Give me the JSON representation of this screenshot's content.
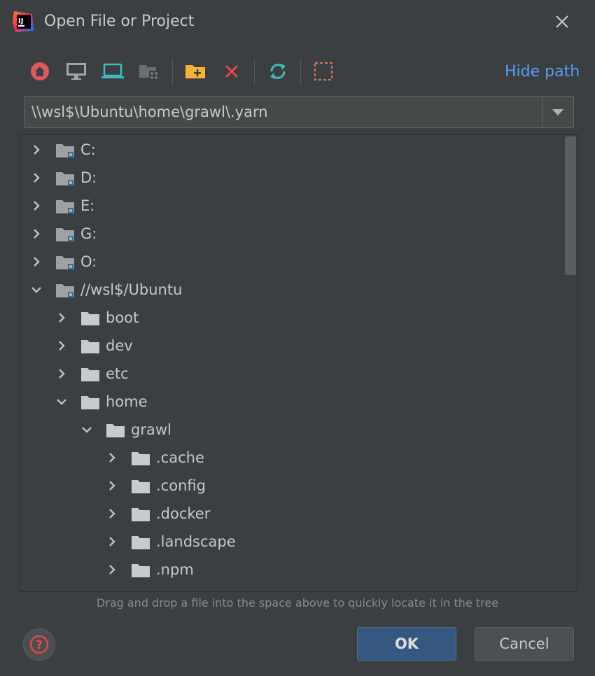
{
  "window": {
    "title": "Open File or Project",
    "icons": {
      "app": "intellij-logo-icon",
      "close": "close-icon"
    }
  },
  "toolbar": {
    "buttons": [
      {
        "name": "home-icon"
      },
      {
        "name": "desktop-icon"
      },
      {
        "name": "project-icon"
      },
      {
        "name": "module-icon"
      },
      {
        "name": "new-folder-icon"
      },
      {
        "name": "delete-icon"
      },
      {
        "name": "refresh-icon"
      },
      {
        "name": "show-hidden-files-icon"
      }
    ],
    "hide_path": "Hide path"
  },
  "path": {
    "value": "\\\\wsl$\\Ubuntu\\home\\grawl\\.yarn"
  },
  "tree": {
    "items": [
      {
        "label": "C:",
        "depth": 0,
        "expanded": false,
        "drive": true
      },
      {
        "label": "D:",
        "depth": 0,
        "expanded": false,
        "drive": true
      },
      {
        "label": "E:",
        "depth": 0,
        "expanded": false,
        "drive": true
      },
      {
        "label": "G:",
        "depth": 0,
        "expanded": false,
        "drive": true
      },
      {
        "label": "O:",
        "depth": 0,
        "expanded": false,
        "drive": true
      },
      {
        "label": "//wsl$/Ubuntu",
        "depth": 0,
        "expanded": true,
        "drive": true
      },
      {
        "label": "boot",
        "depth": 1,
        "expanded": false,
        "drive": false
      },
      {
        "label": "dev",
        "depth": 1,
        "expanded": false,
        "drive": false
      },
      {
        "label": "etc",
        "depth": 1,
        "expanded": false,
        "drive": false
      },
      {
        "label": "home",
        "depth": 1,
        "expanded": true,
        "drive": false
      },
      {
        "label": "grawl",
        "depth": 2,
        "expanded": true,
        "drive": false
      },
      {
        "label": ".cache",
        "depth": 3,
        "expanded": false,
        "drive": false
      },
      {
        "label": ".config",
        "depth": 3,
        "expanded": false,
        "drive": false
      },
      {
        "label": ".docker",
        "depth": 3,
        "expanded": false,
        "drive": false
      },
      {
        "label": ".landscape",
        "depth": 3,
        "expanded": false,
        "drive": false
      },
      {
        "label": ".npm",
        "depth": 3,
        "expanded": false,
        "drive": false
      },
      {
        "label": "",
        "depth": 3,
        "expanded": false,
        "drive": false
      }
    ]
  },
  "hint": "Drag and drop a file into the space above to quickly locate it in the tree",
  "footer": {
    "help_icon": "help-icon",
    "ok": "OK",
    "cancel": "Cancel"
  },
  "colors": {
    "background": "#3c3f41",
    "accent": "#589df6",
    "ok_button": "#365880"
  }
}
